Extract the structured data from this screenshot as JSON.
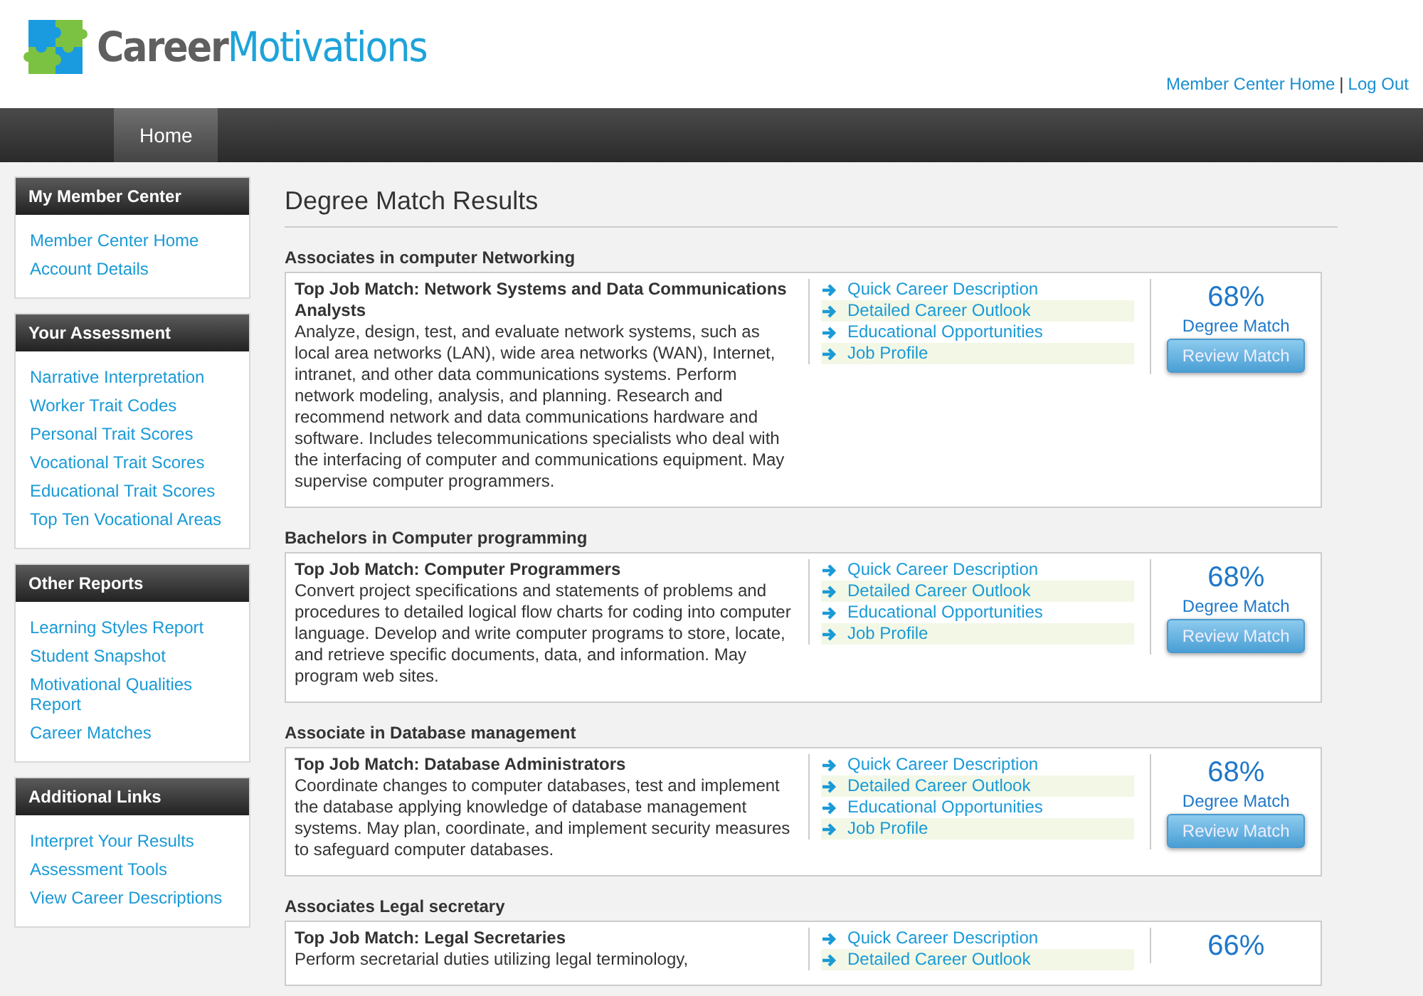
{
  "logo": {
    "first": "Career",
    "second": "Motivations"
  },
  "header_separator": "|",
  "header_links": [
    {
      "label": "Member Center Home"
    },
    {
      "label": "Log Out"
    }
  ],
  "nav": {
    "tabs": [
      {
        "label": "Home",
        "selected": true
      }
    ]
  },
  "sidebar": [
    {
      "title": "My Member Center",
      "items": [
        "Member Center Home",
        "Account Details"
      ]
    },
    {
      "title": "Your Assessment",
      "items": [
        "Narrative Interpretation",
        "Worker Trait Codes",
        "Personal Trait Scores",
        "Vocational Trait Scores",
        "Educational Trait Scores",
        "Top Ten Vocational Areas"
      ]
    },
    {
      "title": "Other Reports",
      "items": [
        "Learning Styles Report",
        "Student Snapshot",
        "Motivational Qualities Report",
        "Career Matches"
      ]
    },
    {
      "title": "Additional Links",
      "items": [
        "Interpret Your Results",
        "Assessment Tools",
        "View Career Descriptions"
      ]
    }
  ],
  "page_title": "Degree Match Results",
  "results": [
    {
      "degree": "Associates in computer Networking",
      "job": "Top Job Match: Network Systems and Data Communications Analysts",
      "description": "Analyze, design, test, and evaluate network systems, such as local area networks (LAN), wide area networks (WAN), Internet, intranet, and other data communications systems. Perform network modeling, analysis, and planning. Research and recommend network and data communications hardware and software. Includes telecommunications specialists who deal with the interfacing of computer and communications equipment. May supervise computer programmers.",
      "links": [
        "Quick Career Description",
        "Detailed Career Outlook",
        "Educational Opportunities",
        "Job Profile"
      ],
      "percent": "68%",
      "match_label": "Degree Match",
      "button": "Review Match"
    },
    {
      "degree": "Bachelors in Computer programming",
      "job": "Top Job Match: Computer Programmers",
      "description": "Convert project specifications and statements of problems and procedures to detailed logical flow charts for coding into computer language. Develop and write computer programs to store, locate, and retrieve specific documents, data, and information. May program web sites.",
      "links": [
        "Quick Career Description",
        "Detailed Career Outlook",
        "Educational Opportunities",
        "Job Profile"
      ],
      "percent": "68%",
      "match_label": "Degree Match",
      "button": "Review Match"
    },
    {
      "degree": "Associate in Database management",
      "job": "Top Job Match: Database Administrators",
      "description": "Coordinate changes to computer databases, test and implement the database applying knowledge of database management systems. May plan, coordinate, and implement security measures to safeguard computer databases.",
      "links": [
        "Quick Career Description",
        "Detailed Career Outlook",
        "Educational Opportunities",
        "Job Profile"
      ],
      "percent": "68%",
      "match_label": "Degree Match",
      "button": "Review Match"
    },
    {
      "degree": "Associates Legal secretary",
      "job": "Top Job Match: Legal Secretaries",
      "description": "Perform secretarial duties utilizing legal terminology,",
      "links": [
        "Quick Career Description",
        "Detailed Career Outlook"
      ],
      "percent": "66%"
    }
  ]
}
